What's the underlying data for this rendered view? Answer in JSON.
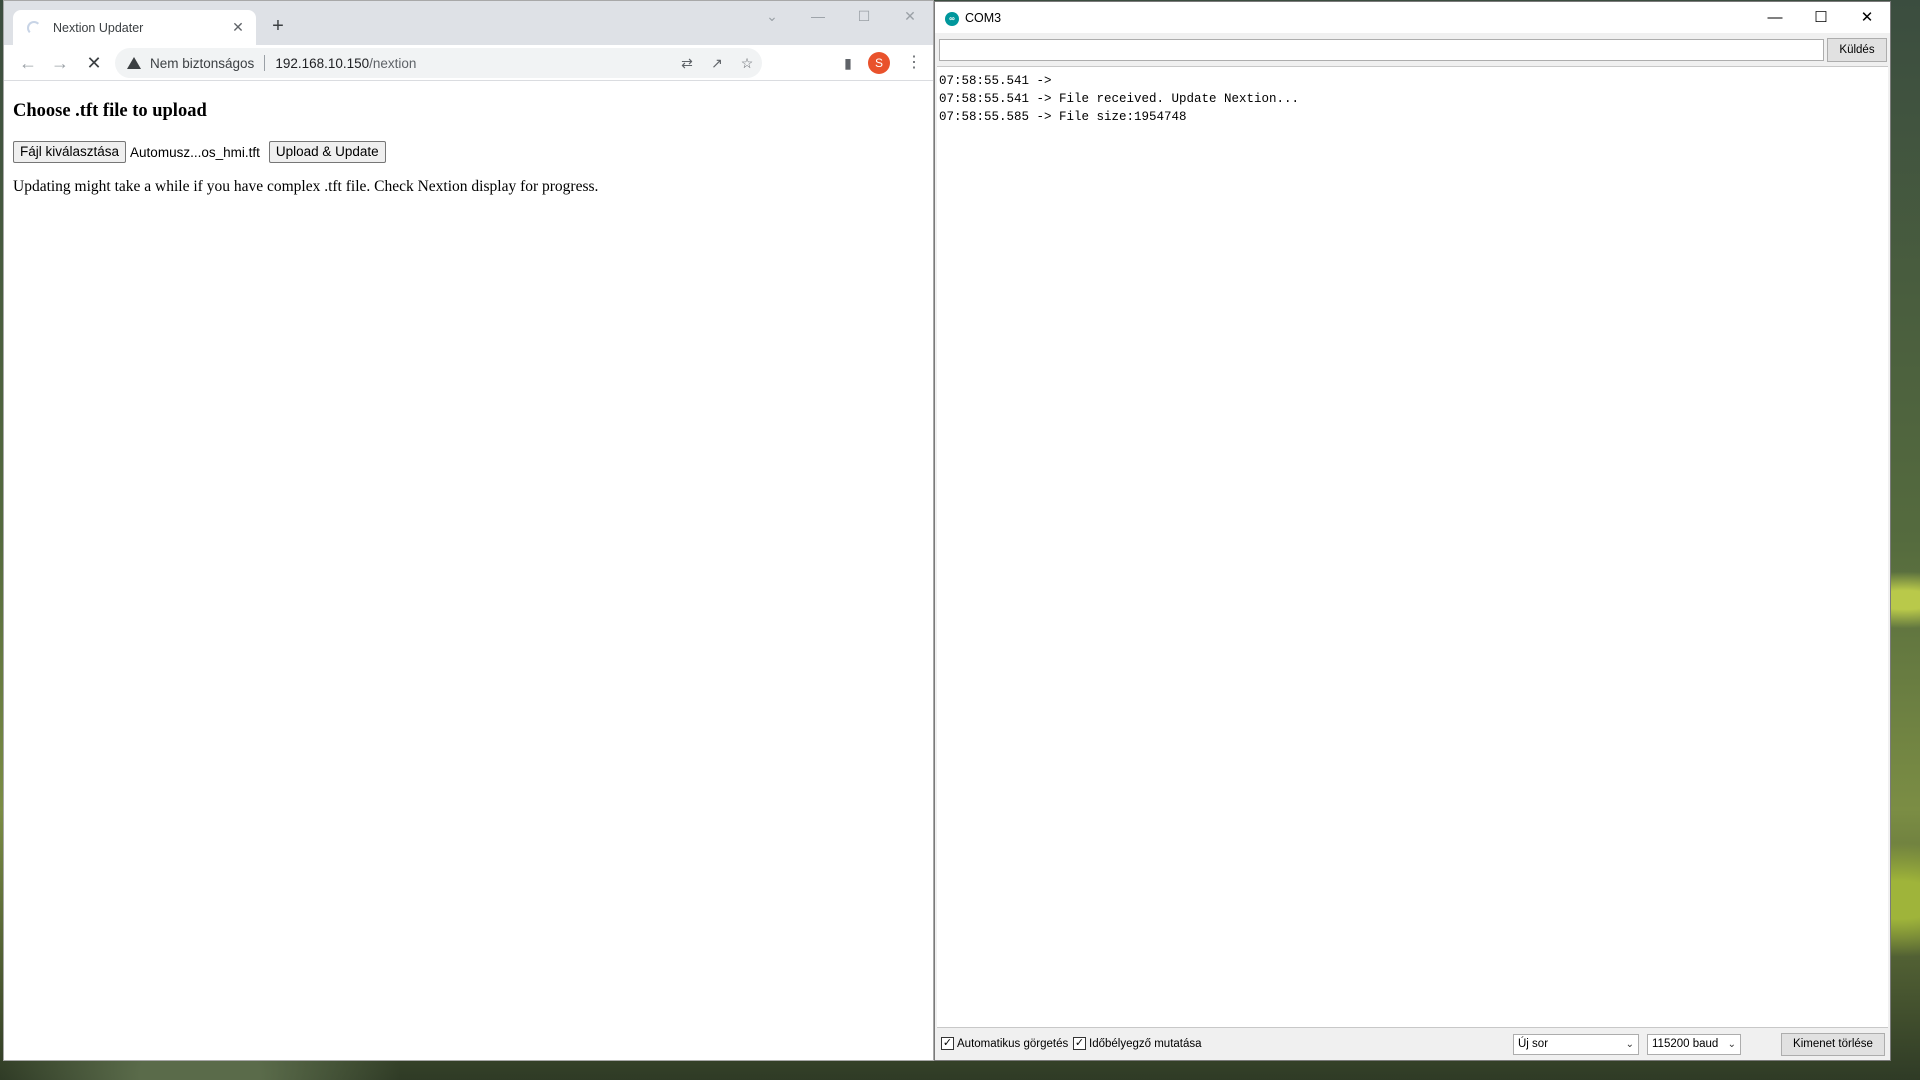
{
  "chrome": {
    "tab_title": "Nextion Updater",
    "tab_close": "✕",
    "new_tab": "+",
    "window_controls": {
      "minimize": "—",
      "maximize": "☐",
      "close": "✕",
      "tab_search": "⌄"
    },
    "nav": {
      "back": "←",
      "forward": "→",
      "reload": "✕"
    },
    "omnibox": {
      "security_label": "Nem biztonságos",
      "url_host": "192.168.10.150",
      "url_path": "/nextion"
    },
    "avatar_letter": "S",
    "page": {
      "heading": "Choose .tft file to upload",
      "choose_button": "Fájl kiválasztása",
      "file_name": "Automusz...os_hmi.tft",
      "upload_button": "Upload & Update",
      "info": "Updating might take a while if you have complex .tft file. Check Nextion display for progress."
    }
  },
  "serial": {
    "title": "COM3",
    "icon_text": "∞",
    "window_controls": {
      "minimize": "—",
      "maximize": "☐",
      "close": "✕"
    },
    "send_label": "Küldés",
    "output_lines": [
      "07:58:55.541 ->",
      "07:58:55.541 -> File received. Update Nextion...",
      "07:58:55.585 -> File size:1954748"
    ],
    "autoscroll_label": "Automatikus görgetés",
    "timestamp_label": "Időbélyegző mutatása",
    "autoscroll_checked": true,
    "timestamp_checked": true,
    "line_ending": "Új sor",
    "baud": "115200 baud",
    "clear_label": "Kimenet törlése"
  },
  "colors": {
    "avatar": "#e9522c",
    "arduino": "#00979c"
  }
}
